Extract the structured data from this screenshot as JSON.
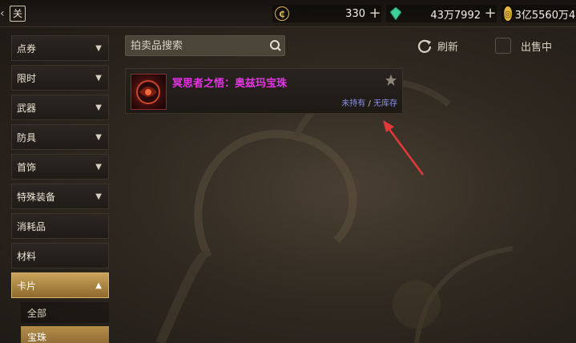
{
  "topbar": {
    "calendar_glyph": "关",
    "currencies": [
      {
        "icon": "coupon-icon",
        "value": "330",
        "color": "#d7b25a"
      },
      {
        "icon": "crystal-icon",
        "value": "43万7992",
        "color": "#3fcf9a"
      },
      {
        "icon": "gold-coin-icon",
        "value": "3亿5560万4",
        "color": "#e0b63d"
      }
    ]
  },
  "sidebar": {
    "categories": [
      {
        "label": "点券",
        "chevron": "expand"
      },
      {
        "label": "限时",
        "chevron": "expand"
      },
      {
        "label": "武器",
        "chevron": "expand"
      },
      {
        "label": "防具",
        "chevron": "expand"
      },
      {
        "label": "首饰",
        "chevron": "expand"
      },
      {
        "label": "特殊装备",
        "chevron": "expand"
      },
      {
        "label": "消耗品"
      },
      {
        "label": "材料"
      },
      {
        "label": "卡片",
        "chevron": "collapse",
        "active": true
      }
    ],
    "subcategories": [
      {
        "label": "全部"
      },
      {
        "label": "宝珠",
        "active": true
      }
    ]
  },
  "search": {
    "placeholder": "拍卖品搜索"
  },
  "toolbar": {
    "refresh_label": "刷新",
    "on_sale_label": "出售中"
  },
  "items": [
    {
      "name": "冥思者之悟：奥兹玛宝珠",
      "name_color": "#e633e6",
      "owned_status": "未持有",
      "separator": "/",
      "stock_status": "无库存"
    }
  ],
  "colors": {
    "accent_gold": "#c9a35a",
    "annotation_red": "#e23a3a"
  }
}
